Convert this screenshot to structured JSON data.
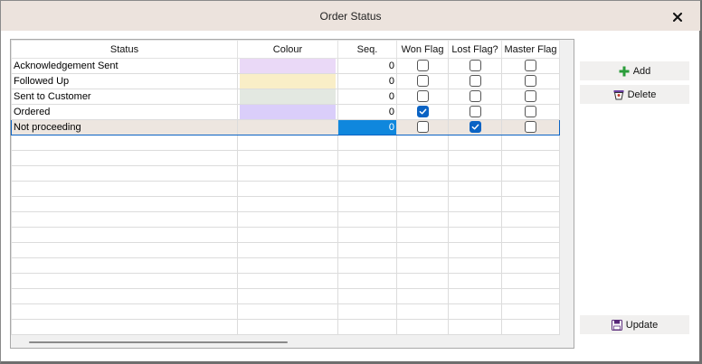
{
  "window": {
    "title": "Order Status"
  },
  "grid": {
    "columns": [
      "Status",
      "Colour",
      "Seq.",
      "Won Flag",
      "Lost Flag?",
      "Master Flag"
    ],
    "rows": [
      {
        "status": "Acknowledgement Sent",
        "colour": "#ead9f7",
        "seq": "0",
        "won": false,
        "lost": false,
        "master": false
      },
      {
        "status": "Followed Up",
        "colour": "#f9eec7",
        "seq": "0",
        "won": false,
        "lost": false,
        "master": false
      },
      {
        "status": "Sent to Customer",
        "colour": "#e3e8e1",
        "seq": "0",
        "won": false,
        "lost": false,
        "master": false
      },
      {
        "status": "Ordered",
        "colour": "#dacefa",
        "seq": "0",
        "won": true,
        "lost": false,
        "master": false
      },
      {
        "status": "Not proceeding",
        "colour": "#ede6e0",
        "seq": "0",
        "won": false,
        "lost": true,
        "master": false
      }
    ],
    "selected_row": 4,
    "empty_rows": 13
  },
  "buttons": {
    "add": "Add",
    "delete": "Delete",
    "update": "Update"
  },
  "icons": {
    "close": "close-icon",
    "add": "plus-icon",
    "delete": "bin-icon",
    "update": "save-icon"
  },
  "colors": {
    "titlebar": "#ece3dd",
    "selection_border": "#0a63c4",
    "active_cell": "#0f87dd",
    "add_icon": "#2a9d3a"
  }
}
